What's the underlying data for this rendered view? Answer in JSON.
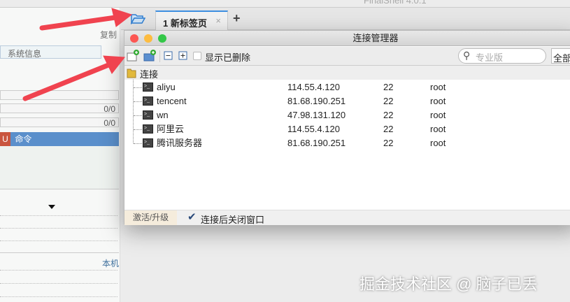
{
  "app_title": "FinalShell 4.0.1",
  "left_panel": {
    "copy_label": "复制",
    "sysinfo_label": "系统信息",
    "counter1": "0/0",
    "counter2": "0/0",
    "badge": "U",
    "command_label": "命令",
    "local_label": "本机"
  },
  "tabs": [
    {
      "label": "1  新标签页"
    }
  ],
  "dialog": {
    "title": "连接管理器",
    "toolbar": {
      "show_deleted": "显示已删除",
      "search_placeholder": "专业版",
      "filter": "全部"
    },
    "folder": "连接",
    "connections": [
      {
        "name": "aliyu",
        "host": "114.55.4.120",
        "port": "22",
        "user": "root"
      },
      {
        "name": "tencent",
        "host": "81.68.190.251",
        "port": "22",
        "user": "root"
      },
      {
        "name": "wn",
        "host": "47.98.131.120",
        "port": "22",
        "user": "root"
      },
      {
        "name": "阿里云",
        "host": "114.55.4.120",
        "port": "22",
        "user": "root"
      },
      {
        "name": "腾讯服务器",
        "host": "81.68.190.251",
        "port": "22",
        "user": "root"
      }
    ],
    "footer": {
      "activate": "激活/升级",
      "close_after_connect": "连接后关闭窗口",
      "close_after_connect_checked": true
    }
  },
  "watermark": "掘金技术社区 @ 脑子已丢"
}
